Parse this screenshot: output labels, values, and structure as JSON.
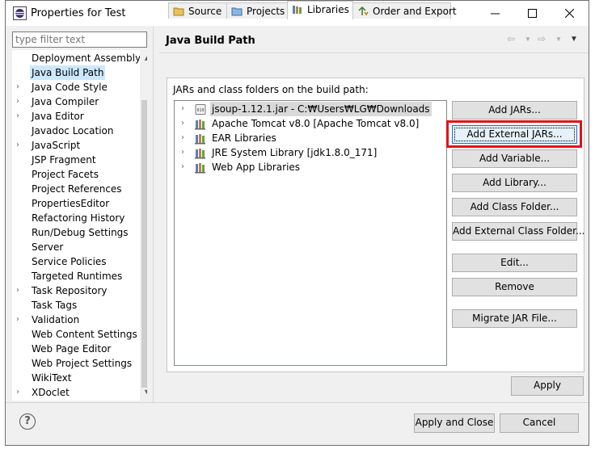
{
  "window": {
    "title": "Properties for Test"
  },
  "filter": {
    "placeholder": "type filter text"
  },
  "tree": {
    "items": [
      {
        "label": "Deployment Assembly",
        "arrow": ""
      },
      {
        "label": "Java Build Path",
        "arrow": "",
        "selected": true
      },
      {
        "label": "Java Code Style",
        "arrow": "›"
      },
      {
        "label": "Java Compiler",
        "arrow": "›"
      },
      {
        "label": "Java Editor",
        "arrow": "›"
      },
      {
        "label": "Javadoc Location",
        "arrow": ""
      },
      {
        "label": "JavaScript",
        "arrow": "›"
      },
      {
        "label": "JSP Fragment",
        "arrow": ""
      },
      {
        "label": "Project Facets",
        "arrow": ""
      },
      {
        "label": "Project References",
        "arrow": ""
      },
      {
        "label": "PropertiesEditor",
        "arrow": ""
      },
      {
        "label": "Refactoring History",
        "arrow": ""
      },
      {
        "label": "Run/Debug Settings",
        "arrow": ""
      },
      {
        "label": "Server",
        "arrow": ""
      },
      {
        "label": "Service Policies",
        "arrow": ""
      },
      {
        "label": "Targeted Runtimes",
        "arrow": ""
      },
      {
        "label": "Task Repository",
        "arrow": "›"
      },
      {
        "label": "Task Tags",
        "arrow": ""
      },
      {
        "label": "Validation",
        "arrow": "›"
      },
      {
        "label": "Web Content Settings",
        "arrow": ""
      },
      {
        "label": "Web Page Editor",
        "arrow": ""
      },
      {
        "label": "Web Project Settings",
        "arrow": ""
      },
      {
        "label": "WikiText",
        "arrow": ""
      },
      {
        "label": "XDoclet",
        "arrow": "›"
      }
    ]
  },
  "page": {
    "title": "Java Build Path"
  },
  "tabs": [
    {
      "label": "Source",
      "icon": "source-folder-icon"
    },
    {
      "label": "Projects",
      "icon": "projects-icon"
    },
    {
      "label": "Libraries",
      "icon": "libraries-icon",
      "active": true
    },
    {
      "label": "Order and Export",
      "icon": "order-export-icon"
    }
  ],
  "libraries": {
    "caption": "JARs and class folders on the build path:",
    "items": [
      {
        "label": "jsoup-1.12.1.jar - C:₩Users₩LG₩Downloads",
        "icon": "jar-icon",
        "selected": true
      },
      {
        "label": "Apache Tomcat v8.0 [Apache Tomcat v8.0]",
        "icon": "library-icon"
      },
      {
        "label": "EAR Libraries",
        "icon": "library-icon"
      },
      {
        "label": "JRE System Library [jdk1.8.0_171]",
        "icon": "library-icon"
      },
      {
        "label": "Web App Libraries",
        "icon": "library-icon"
      }
    ]
  },
  "buttons": {
    "add_jars": "Add JARs...",
    "add_external_jars": "Add External JARs...",
    "add_variable": "Add Variable...",
    "add_library": "Add Library...",
    "add_class_folder": "Add Class Folder...",
    "add_external_class_folder": "Add External Class Folder...",
    "edit": "Edit...",
    "remove": "Remove",
    "migrate_jar": "Migrate JAR File...",
    "apply": "Apply",
    "apply_and_close": "Apply and Close",
    "cancel": "Cancel"
  },
  "colors": {
    "highlight": "#e0101b",
    "selection": "#cce8ff",
    "focus_border": "#0078d7"
  }
}
